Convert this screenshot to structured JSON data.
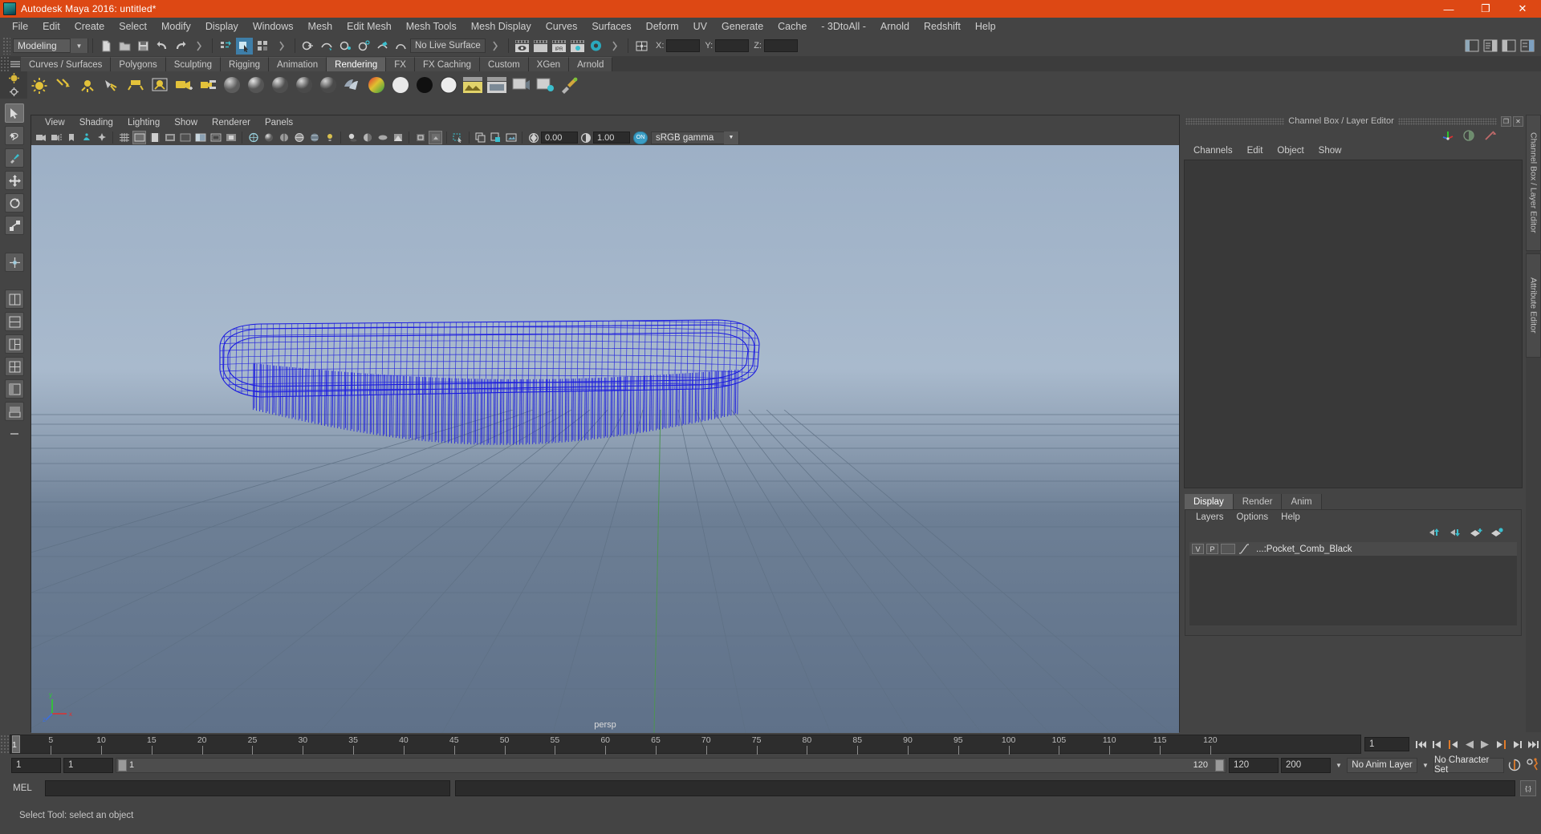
{
  "titlebar": {
    "title": "Autodesk Maya 2016: untitled*",
    "minimize": "—",
    "maximize": "❐",
    "close": "✕"
  },
  "menubar": {
    "items": [
      "File",
      "Edit",
      "Create",
      "Select",
      "Modify",
      "Display",
      "Windows",
      "Mesh",
      "Edit Mesh",
      "Mesh Tools",
      "Mesh Display",
      "Curves",
      "Surfaces",
      "Deform",
      "UV",
      "Generate",
      "Cache",
      "- 3DtoAll -",
      "Arnold",
      "Redshift",
      "Help"
    ]
  },
  "statusline": {
    "mode": "Modeling",
    "live_surface": "No Live Surface",
    "x_label": "X:",
    "y_label": "Y:",
    "z_label": "Z:",
    "x_value": "",
    "y_value": "",
    "z_value": ""
  },
  "shelf": {
    "tabs": [
      "Curves / Surfaces",
      "Polygons",
      "Sculpting",
      "Rigging",
      "Animation",
      "Rendering",
      "FX",
      "FX Caching",
      "Custom",
      "XGen",
      "Arnold"
    ],
    "active_tab": "Rendering"
  },
  "viewport": {
    "menus": [
      "View",
      "Shading",
      "Lighting",
      "Show",
      "Renderer",
      "Panels"
    ],
    "exposure_value": "0.00",
    "gamma_value": "1.00",
    "color_management": "sRGB gamma",
    "gamma_toggle": "ON",
    "camera_label": "persp",
    "axis_x": "x",
    "axis_y": "y",
    "axis_z": "z"
  },
  "channelbox": {
    "panel_title": "Channel Box / Layer Editor",
    "menus": [
      "Channels",
      "Edit",
      "Object",
      "Show"
    ],
    "maximize_glyph": "❐",
    "close_glyph": "✕"
  },
  "layer_editor": {
    "tabs": [
      "Display",
      "Render",
      "Anim"
    ],
    "active_tab": "Display",
    "menus": [
      "Layers",
      "Options",
      "Help"
    ],
    "layers": [
      {
        "visible": "V",
        "playback": "P",
        "name": "...:Pocket_Comb_Black"
      }
    ]
  },
  "side_tabs": [
    "Channel Box / Layer Editor",
    "Attribute Editor"
  ],
  "timeline": {
    "ticks": [
      5,
      10,
      15,
      20,
      25,
      30,
      35,
      40,
      45,
      50,
      55,
      60,
      65,
      70,
      75,
      80,
      85,
      90,
      95,
      100,
      105,
      110,
      115,
      120
    ],
    "current_frame": "1",
    "current_frame_field": "1",
    "range_start": "1",
    "range_end": "1",
    "playback_start": "1",
    "playback_end": "120",
    "anim_end": "120",
    "scene_end": "200",
    "anim_layer": "No Anim Layer",
    "character_set": "No Character Set",
    "playback_buttons": [
      "go-to-start",
      "step-back-key",
      "step-back-frame",
      "play-backwards",
      "play-forwards",
      "step-forward-frame",
      "step-forward-key",
      "go-to-end"
    ]
  },
  "command_line": {
    "label": "MEL",
    "value": "",
    "script_editor_glyph": "{;}"
  },
  "help_line": {
    "text": "Select Tool: select an object"
  },
  "colors": {
    "title_bar": "#dd4814",
    "panel_bg": "#444444",
    "accent_blue": "#3e7ea8",
    "wireframe": "#1a1ae0",
    "highlight_teal": "#3bbfce"
  }
}
